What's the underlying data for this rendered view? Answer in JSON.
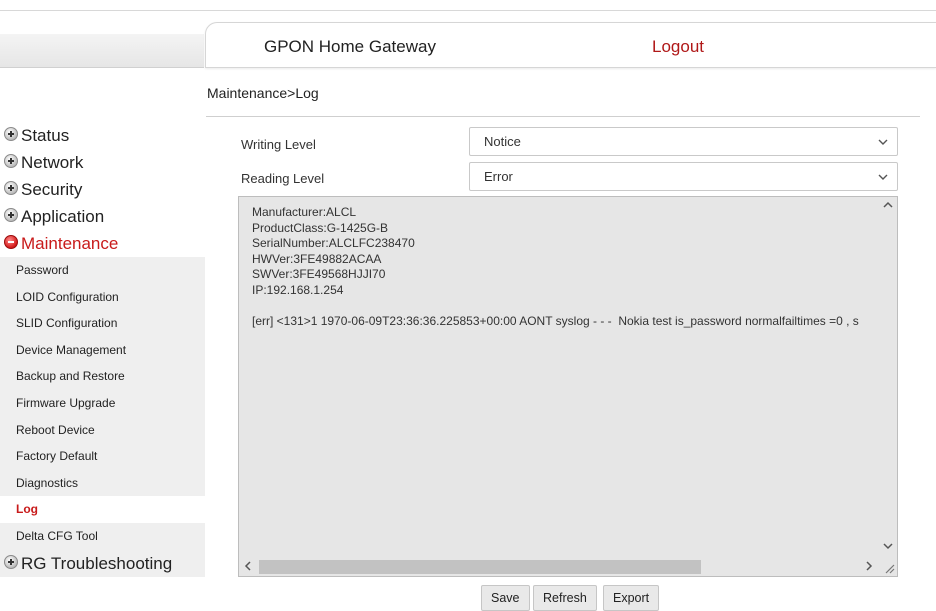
{
  "header": {
    "title": "GPON Home Gateway",
    "logout": "Logout"
  },
  "breadcrumb": "Maintenance>Log",
  "sidebar": {
    "sections": [
      {
        "label": "Status",
        "expanded": false
      },
      {
        "label": "Network",
        "expanded": false
      },
      {
        "label": "Security",
        "expanded": false
      },
      {
        "label": "Application",
        "expanded": false
      },
      {
        "label": "Maintenance",
        "expanded": true
      }
    ],
    "maintenance_items": [
      {
        "label": "Password"
      },
      {
        "label": "LOID Configuration"
      },
      {
        "label": "SLID Configuration"
      },
      {
        "label": "Device Management"
      },
      {
        "label": "Backup and Restore"
      },
      {
        "label": "Firmware Upgrade"
      },
      {
        "label": "Reboot Device"
      },
      {
        "label": "Factory Default"
      },
      {
        "label": "Diagnostics"
      },
      {
        "label": "Log",
        "active": true
      },
      {
        "label": "Delta CFG Tool"
      }
    ],
    "rg_troubleshooting": "RG Troubleshooting"
  },
  "form": {
    "writing_level_label": "Writing Level",
    "writing_level_value": "Notice",
    "reading_level_label": "Reading Level",
    "reading_level_value": "Error"
  },
  "log": {
    "text": "Manufacturer:ALCL\nProductClass:G-1425G-B\nSerialNumber:ALCLFC238470\nHWVer:3FE49882ACAA\nSWVer:3FE49568HJJI70\nIP:192.168.1.254\n\n[err] <131>1 1970-06-09T23:36:36.225853+00:00 AONT syslog - - -  Nokia test is_password normalfailtimes =0 , s"
  },
  "buttons": {
    "save": "Save",
    "refresh": "Refresh",
    "export": "Export"
  },
  "colors": {
    "accent_red": "#c81a1a",
    "logout_red": "#b01818"
  }
}
